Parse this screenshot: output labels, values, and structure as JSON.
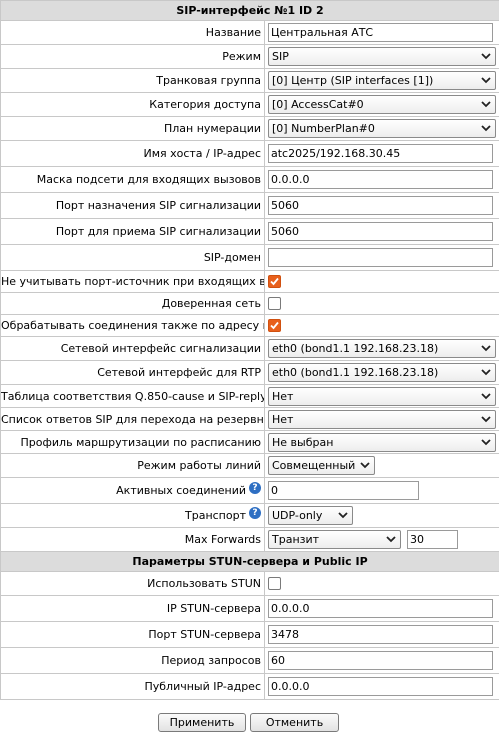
{
  "title": "SIP-интерфейс №1 ID 2",
  "fields": {
    "name": {
      "label": "Название",
      "value": "Центральная АТС"
    },
    "mode": {
      "label": "Режим",
      "value": "SIP"
    },
    "trunk_group": {
      "label": "Транковая группа",
      "value": "[0] Центр (SIP interfaces [1])"
    },
    "access_category": {
      "label": "Категория доступа",
      "value": "[0] AccessCat#0"
    },
    "numbering_plan": {
      "label": "План нумерации",
      "value": "[0] NumberPlan#0"
    },
    "host": {
      "label": "Имя хоста / IP-адрес",
      "value": "atc2025/192.168.30.45"
    },
    "subnet_mask": {
      "label": "Маска подсети для входящих вызовов",
      "value": "0.0.0.0"
    },
    "dest_port": {
      "label": "Порт назначения SIP сигнализации",
      "value": "5060"
    },
    "recv_port": {
      "label": "Порт для приема SIP сигнализации",
      "value": "5060"
    },
    "sip_domain": {
      "label": "SIP-домен",
      "value": ""
    },
    "ignore_src_port": {
      "label": "Не учитывать порт-источник при входящих вызовах",
      "checked": true
    },
    "trusted_net": {
      "label": "Доверенная сеть",
      "checked": false
    },
    "via_handling": {
      "label": "Обрабатывать соединения также по адресу из Via",
      "checked": true
    },
    "sig_iface": {
      "label": "Сетевой интерфейс сигнализации",
      "value": "eth0 (bond1.1 192.168.23.18)"
    },
    "rtp_iface": {
      "label": "Сетевой интерфейс для RTP",
      "value": "eth0 (bond1.1 192.168.23.18)"
    },
    "q850_table": {
      "label": "Таблица соответствия Q.850-cause и SIP-reply",
      "value": "Нет"
    },
    "sip_reply_list": {
      "label": "Список ответов SIP для перехода на резервную ТГ",
      "value": "Нет"
    },
    "routing_profile": {
      "label": "Профиль маршрутизации по расписанию",
      "value": "Не выбран"
    },
    "line_mode": {
      "label": "Режим работы линий",
      "value": "Совмещенный"
    },
    "active_conns": {
      "label": "Активных соединений",
      "value": "0"
    },
    "transport": {
      "label": "Транспорт",
      "value": "UDP-only"
    },
    "max_forwards": {
      "label": "Max Forwards",
      "value": "Транзит",
      "number": "30"
    }
  },
  "stun": {
    "title": "Параметры STUN-сервера и Public IP",
    "use": {
      "label": "Использовать STUN",
      "checked": false
    },
    "ip": {
      "label": "IP STUN-сервера",
      "value": "0.0.0.0"
    },
    "port": {
      "label": "Порт STUN-сервера",
      "value": "3478"
    },
    "period": {
      "label": "Период запросов",
      "value": "60"
    },
    "public_ip": {
      "label": "Публичный IP-адрес",
      "value": "0.0.0.0"
    }
  },
  "buttons": {
    "apply": "Применить",
    "cancel": "Отменить"
  },
  "icons": {
    "help": "help-icon",
    "checkbox_accent": "#e8601c"
  }
}
